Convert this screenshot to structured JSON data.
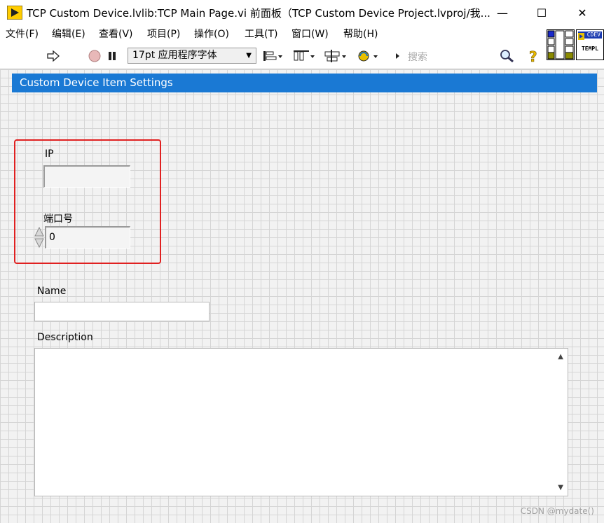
{
  "window": {
    "title": "TCP Custom Device.lvlib:TCP Main Page.vi 前面板（TCP Custom Device Project.lvproj/我...",
    "minimize_glyph": "—",
    "maximize_glyph": "☐",
    "close_glyph": "✕"
  },
  "menu": [
    {
      "label": "文件(F)"
    },
    {
      "label": "编辑(E)"
    },
    {
      "label": "查看(V)"
    },
    {
      "label": "项目(P)"
    },
    {
      "label": "操作(O)"
    },
    {
      "label": "工具(T)"
    },
    {
      "label": "窗口(W)"
    },
    {
      "label": "帮助(H)"
    }
  ],
  "toolbar": {
    "run_icon": "run-arrow-icon",
    "abort_icon": "abort-stop-icon",
    "pause_icon": "pause-icon",
    "font_select": "17pt 应用程序字体",
    "align_icon": "align-objects-icon",
    "distribute_icon": "distribute-objects-icon",
    "resize_icon": "resize-objects-icon",
    "reorder_icon": "reorder-icon",
    "search_placeholder": "搜索",
    "help_glyph": "?"
  },
  "vi_icon": {
    "badge": "CDEV",
    "text": "TEMPL"
  },
  "panel": {
    "header": "Custom Device Item Settings",
    "ip_label": "IP",
    "ip_value": "",
    "port_label": "端口号",
    "port_value": "0",
    "name_label": "Name",
    "name_value": "",
    "description_label": "Description",
    "description_value": ""
  },
  "watermark": "CSDN @mydate()",
  "colors": {
    "header_bg": "#1a79d4",
    "highlight": "#e02020",
    "grid": "#d5d5d5"
  }
}
